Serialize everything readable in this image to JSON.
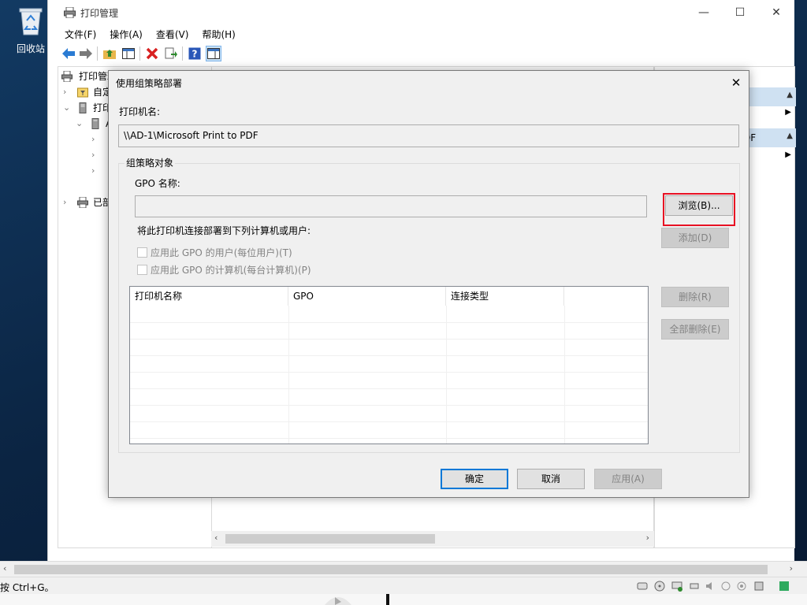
{
  "desktop": {
    "recycle_bin_label": "回收站"
  },
  "window": {
    "title": "打印管理",
    "controls": {
      "minimize": "—",
      "maximize": "☐",
      "close": "✕"
    },
    "menu": [
      "文件(F)",
      "操作(A)",
      "查看(V)",
      "帮助(H)"
    ]
  },
  "tree": {
    "items": [
      {
        "label": "打印管理",
        "arrow": ""
      },
      {
        "label": "自定",
        "arrow": "›"
      },
      {
        "label": "打印",
        "arrow": "⌄"
      },
      {
        "label": "A",
        "arrow": "⌄"
      },
      {
        "label": "",
        "arrow": "›"
      },
      {
        "label": "",
        "arrow": "›"
      },
      {
        "label": "",
        "arrow": "›"
      },
      {
        "label": "已部",
        "arrow": "›"
      }
    ]
  },
  "actions_pane": {
    "second_header_fragment": "DF"
  },
  "statusbar": {
    "text": "按 Ctrl+G。"
  },
  "dialog": {
    "title": "使用组策略部署",
    "close": "✕",
    "printer_name_label": "打印机名:",
    "printer_name_value": "\\\\AD-1\\Microsoft Print to PDF",
    "group_label": "组策略对象",
    "gpo_name_label": "GPO 名称:",
    "gpo_name_value": "",
    "browse_button": "浏览(B)...",
    "deploy_label": "将此打印机连接部署到下列计算机或用户:",
    "add_button": "添加(D)",
    "checkbox_user": "应用此 GPO 的用户(每位用户)(T)",
    "checkbox_computer": "应用此 GPO 的计算机(每台计算机)(P)",
    "list_columns": [
      "打印机名称",
      "GPO",
      "连接类型"
    ],
    "remove_button": "删除(R)",
    "remove_all_button": "全部删除(E)",
    "ok_button": "确定",
    "cancel_button": "取消",
    "apply_button": "应用(A)"
  },
  "colors": {
    "accent": "#0078d7",
    "highlight_border": "#e81123",
    "dialog_bg": "#f0f0f0",
    "desktop_bg": "#0f2a4a"
  }
}
